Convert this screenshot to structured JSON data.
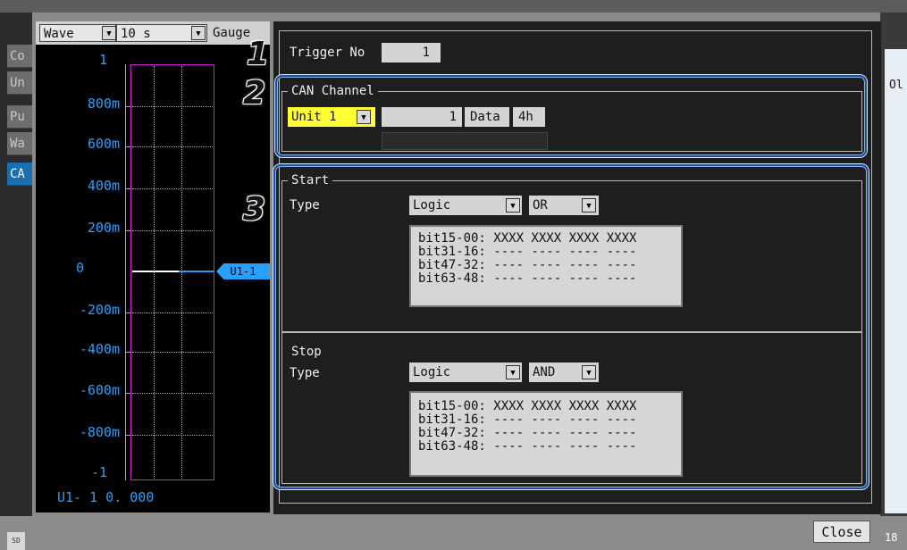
{
  "side_tabs": [
    "Co",
    "Un",
    "Pu",
    "Wa",
    "CA"
  ],
  "graph": {
    "display_mode": "Wave",
    "time_div": "10 s",
    "gauge_label": "Gauge",
    "y_labels": [
      "1",
      "800m",
      "600m",
      "400m",
      "200m",
      "0",
      "-200m",
      "-400m",
      "-600m",
      "-800m",
      "-1"
    ],
    "channel_marker": "U1-1",
    "footer_value": "U1-  1 0. 000"
  },
  "right_label": "Ol",
  "right_number": "18",
  "sd_label": "SD",
  "callouts": [
    "1",
    "2",
    "3"
  ],
  "trigger": {
    "label": "Trigger No",
    "value": "1"
  },
  "can_channel": {
    "title": "CAN Channel",
    "unit": "Unit 1",
    "channel_no": "1",
    "data_label": "Data",
    "data_value": "4h"
  },
  "start": {
    "title": "Start",
    "type_label": "Type",
    "type_value": "Logic",
    "op_value": "OR",
    "bits": [
      "bit15-00: XXXX XXXX XXXX XXXX",
      "bit31-16: ---- ---- ---- ----",
      "bit47-32: ---- ---- ---- ----",
      "bit63-48: ---- ---- ---- ----"
    ]
  },
  "stop": {
    "title": "Stop",
    "type_label": "Type",
    "type_value": "Logic",
    "op_value": "AND",
    "bits": [
      "bit15-00: XXXX XXXX XXXX XXXX",
      "bit31-16: ---- ---- ---- ----",
      "bit47-32: ---- ---- ---- ----",
      "bit63-48: ---- ---- ---- ----"
    ]
  },
  "close_label": "Close",
  "colors": {
    "accent_blue": "#28a0ff",
    "highlight_yellow": "#ffff33",
    "plot_magenta": "#d020d0"
  }
}
